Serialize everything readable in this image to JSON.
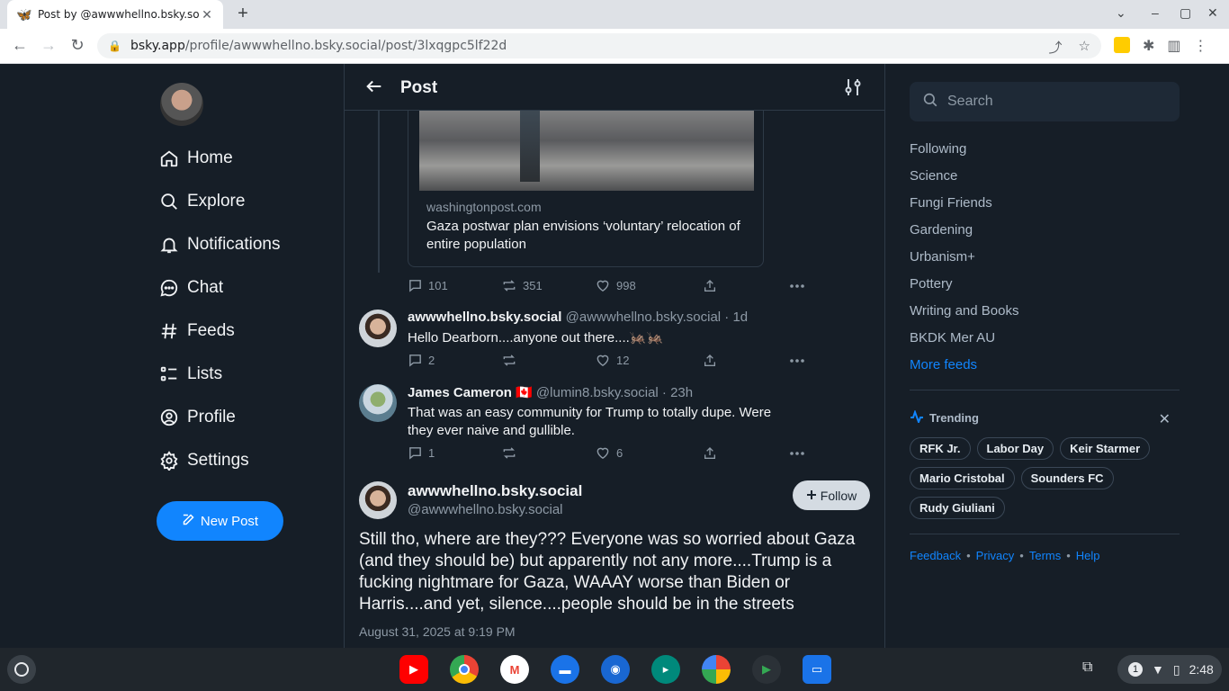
{
  "browser": {
    "tab_title": "Post by @awwwhellno.bsky.social",
    "url_host": "bsky.app",
    "url_path": "/profile/awwwhellno.bsky.social/post/3lxqgpc5lf22d"
  },
  "nav": {
    "items": [
      {
        "label": "Home",
        "icon": "home-icon"
      },
      {
        "label": "Explore",
        "icon": "search-icon"
      },
      {
        "label": "Notifications",
        "icon": "bell-icon"
      },
      {
        "label": "Chat",
        "icon": "chat-icon"
      },
      {
        "label": "Feeds",
        "icon": "hash-icon"
      },
      {
        "label": "Lists",
        "icon": "list-icon"
      },
      {
        "label": "Profile",
        "icon": "user-icon"
      },
      {
        "label": "Settings",
        "icon": "gear-icon"
      }
    ],
    "new_post": "New Post"
  },
  "header": {
    "title": "Post"
  },
  "embed": {
    "domain": "washingtonpost.com",
    "title": "Gaza postwar plan envisions ‘voluntary’ relocation of entire population",
    "replies": "101",
    "reposts": "351",
    "likes": "998"
  },
  "replies": [
    {
      "name": "awwwhellno.bsky.social",
      "meta": "@awwwhellno.bsky.social · 1d",
      "text": "Hello Dearborn....anyone out there....🦗🦗",
      "replies": "2",
      "reposts": "",
      "likes": "12"
    },
    {
      "name": "James Cameron 🇨🇦",
      "meta": "@lumin8.bsky.social · 23h",
      "text": "That was an easy community for Trump to totally dupe. Were they ever naive and gullible.",
      "replies": "1",
      "reposts": "",
      "likes": "6"
    }
  ],
  "main_post": {
    "name": "awwwhellno.bsky.social",
    "handle": "@awwwhellno.bsky.social",
    "follow": "Follow",
    "text": "Still tho, where are they??? Everyone was so worried about Gaza (and they should be) but apparently not any more....Trump is a fucking nightmare for Gaza, WAAAY worse than Biden or Harris....and yet, silence....people should be in the streets",
    "timestamp": "August 31, 2025 at 9:19 PM"
  },
  "right": {
    "search_placeholder": "Search",
    "feeds": [
      "Following",
      "Science",
      "Fungi Friends",
      "Gardening",
      "Urbanism+",
      "Pottery",
      "Writing and Books",
      "BKDK Mer AU"
    ],
    "more_feeds": "More feeds",
    "trending_title": "Trending",
    "trending": [
      "RFK Jr.",
      "Labor Day",
      "Keir Starmer",
      "Mario Cristobal",
      "Sounders FC",
      "Rudy Giuliani"
    ],
    "footer": [
      "Feedback",
      "Privacy",
      "Terms",
      "Help"
    ]
  },
  "shelf": {
    "apps": [
      "youtube-icon",
      "chrome-icon",
      "gmail-icon",
      "messages-icon",
      "camera-icon",
      "meet-icon",
      "photos-icon",
      "play-store-icon",
      "files-icon"
    ],
    "notification_count": "1",
    "time": "2:48"
  },
  "colors": {
    "accent": "#1185fe",
    "background": "#161e27",
    "border": "#2e3a47"
  }
}
